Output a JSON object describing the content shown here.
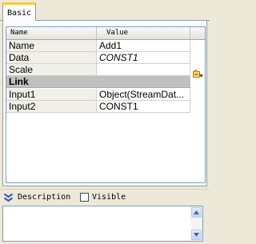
{
  "tabs": [
    {
      "label": "Basic",
      "active": true
    }
  ],
  "grid": {
    "columns": [
      "Name",
      "Value"
    ],
    "rows": [
      {
        "name": "Name",
        "value": "Add1"
      },
      {
        "name": "Data",
        "value": "CONST1"
      },
      {
        "name": "Scale",
        "value": ""
      },
      {
        "category": "Link"
      },
      {
        "name": "Input1",
        "value": "Object(StreamDat..."
      },
      {
        "name": "Input2",
        "value": "CONST1"
      }
    ]
  },
  "description": {
    "label": "Description",
    "visible_label": "Visible",
    "visible_checked": false,
    "text": ""
  },
  "icons": {
    "collapse": "chevron-double-down-icon",
    "edit": "edit-value-icon"
  },
  "colors": {
    "tab_highlight": "#ffc83c",
    "category_bg": "#c0c0c0",
    "collapse_icon": "#2b5bb8"
  }
}
